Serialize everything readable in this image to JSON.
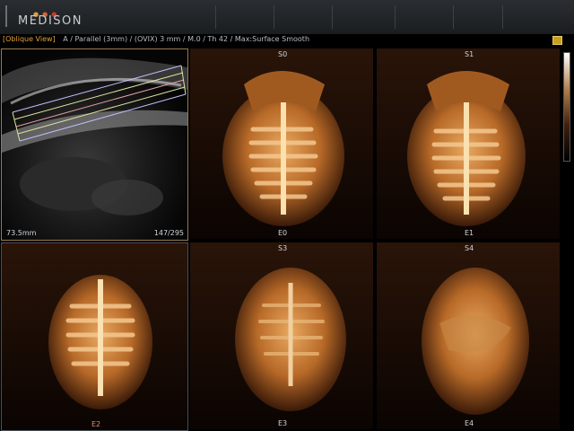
{
  "brand": {
    "name": "MEDISON"
  },
  "status": {
    "mode": "[Oblique View]",
    "params": "A / Parallel (3mm) / (OVIX) 3 mm / M.0 / Th 42 / Max:Surface Smooth"
  },
  "reference_view": {
    "depth_text": "73.5mm",
    "slice_text": "147/295"
  },
  "views": [
    {
      "top_marker": "S0",
      "bottom_marker": "E0"
    },
    {
      "top_marker": "S1",
      "bottom_marker": "E1"
    },
    {
      "top_marker": "",
      "bottom_marker": "E2"
    },
    {
      "top_marker": "S3",
      "bottom_marker": "E3"
    },
    {
      "top_marker": "S4",
      "bottom_marker": "E4"
    }
  ],
  "icons": {
    "corner": "settings-icon",
    "scale": "grayscale-bar-icon"
  },
  "colors": {
    "background": "#000000",
    "accent": "#e0a040",
    "render_tone": "#c8803a",
    "border_active": "#9a7a50"
  }
}
